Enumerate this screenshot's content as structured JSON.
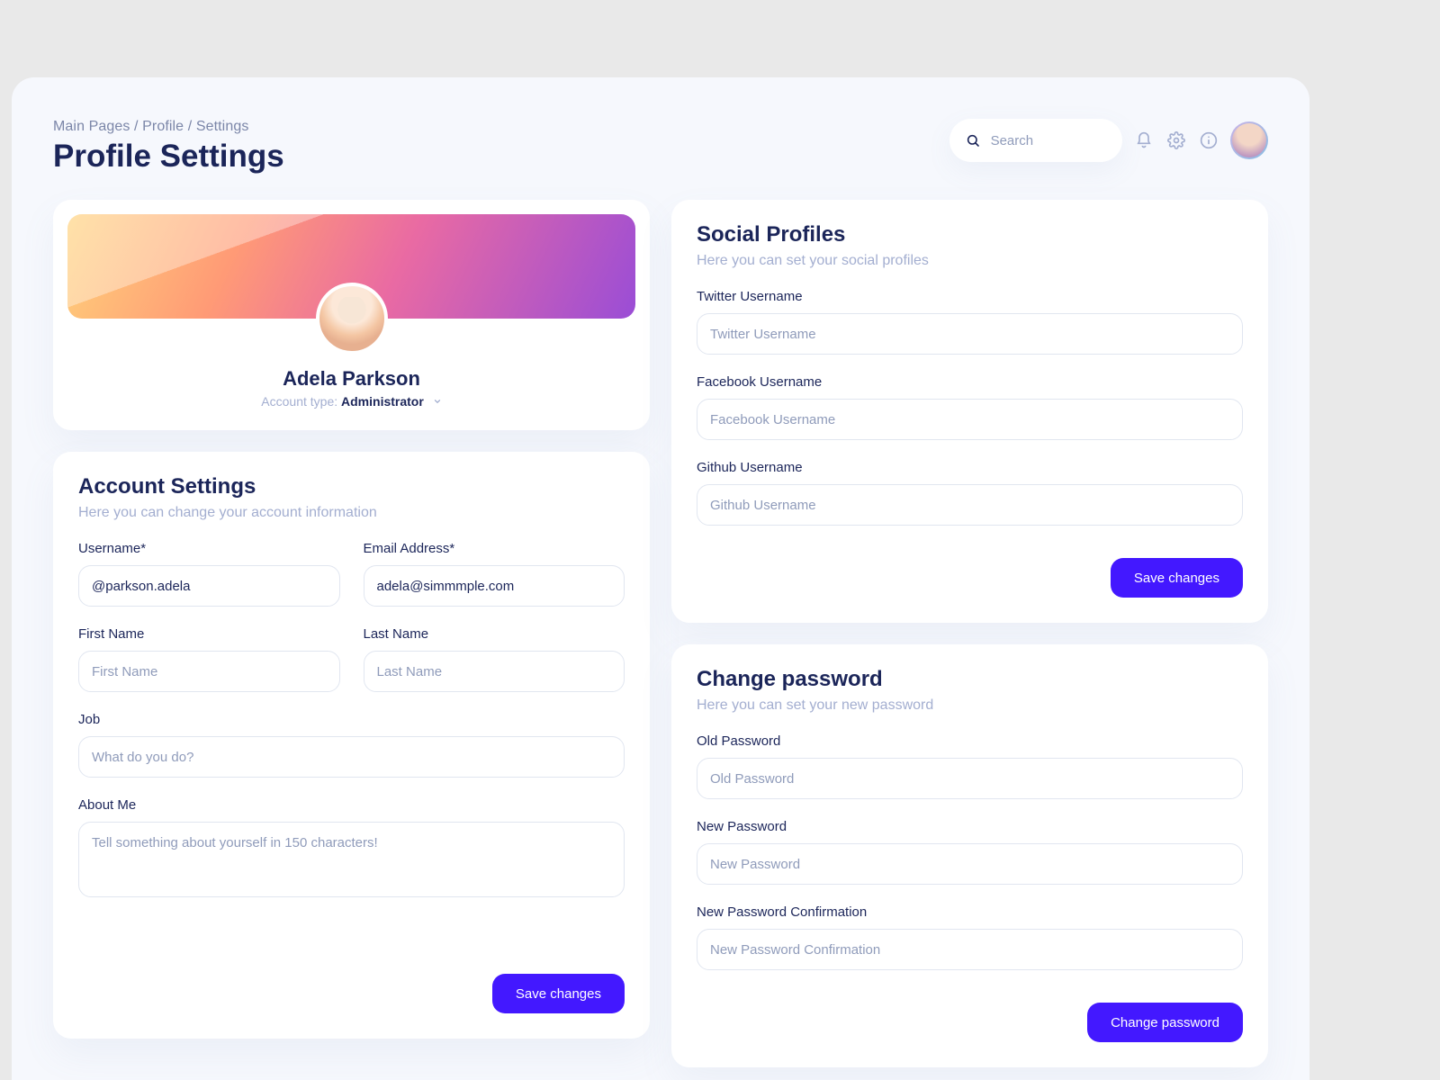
{
  "breadcrumb": "Main Pages / Profile / Settings",
  "page_title": "Profile Settings",
  "search": {
    "placeholder": "Search"
  },
  "profile": {
    "name": "Adela Parkson",
    "account_type_label": "Account type:",
    "account_type_value": "Administrator"
  },
  "account": {
    "title": "Account Settings",
    "subtitle": "Here you can change your account information",
    "fields": {
      "username": {
        "label": "Username*",
        "value": "@parkson.adela"
      },
      "email": {
        "label": "Email Address*",
        "value": "adela@simmmple.com"
      },
      "first": {
        "label": "First Name",
        "placeholder": "First Name"
      },
      "last": {
        "label": "Last Name",
        "placeholder": "Last Name"
      },
      "job": {
        "label": "Job",
        "placeholder": "What do you do?"
      },
      "about": {
        "label": "About Me",
        "placeholder": "Tell something about yourself in 150 characters!"
      }
    },
    "save": "Save changes"
  },
  "social": {
    "title": "Social Profiles",
    "subtitle": "Here you can set your social profiles",
    "fields": {
      "twitter": {
        "label": "Twitter Username",
        "placeholder": "Twitter Username"
      },
      "facebook": {
        "label": "Facebook Username",
        "placeholder": "Facebook Username"
      },
      "github": {
        "label": "Github Username",
        "placeholder": "Github Username"
      }
    },
    "save": "Save changes"
  },
  "password": {
    "title": "Change password",
    "subtitle": "Here you can set your new password",
    "fields": {
      "old": {
        "label": "Old Password",
        "placeholder": "Old Password"
      },
      "new": {
        "label": "New Password",
        "placeholder": "New Password"
      },
      "confirm": {
        "label": "New Password Confirmation",
        "placeholder": "New Password Confirmation"
      }
    },
    "save": "Change password"
  }
}
